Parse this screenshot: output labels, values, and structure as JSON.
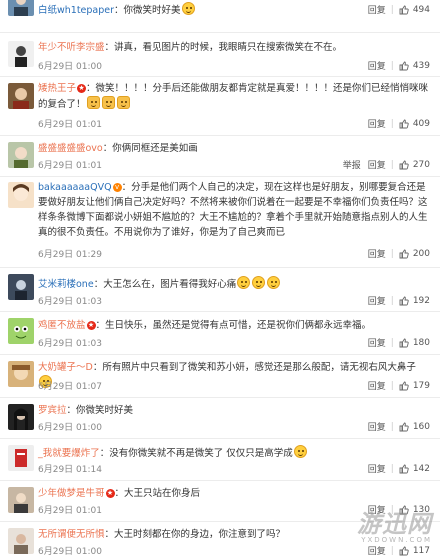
{
  "ui": {
    "reply_label": "回复",
    "report_label": "举报",
    "separator": "|"
  },
  "comments": [
    {
      "user": "白纸wh1tepaper",
      "badge": "",
      "text": "：你微笑时好美",
      "emojis": [
        "cry"
      ],
      "time": "",
      "likes": "494"
    },
    {
      "user": "年少不听李宗盛",
      "badge": "",
      "text": "：讲真，看见图片的时候，我眼睛只在搜索微笑在不在。",
      "time": "6月29日 01:00",
      "likes": "439"
    },
    {
      "user": "矮热王子",
      "badge": "star",
      "text": "：微笑！！！！分手后还能做朋友都肯定就是真爱！！！！还是你们已经悄悄咪咪的复合了！",
      "emojis": [
        "cat",
        "cat",
        "cat"
      ],
      "time": "6月29日 01:01",
      "likes": "409"
    },
    {
      "user": "盛盛盛盛盛ovo",
      "badge": "",
      "text": "：你俩同框还是美如画",
      "time": "6月29日 01:01",
      "likes": "270",
      "report": true
    },
    {
      "user": "bakaaaaaaQVQ",
      "badge": "v",
      "text": "：分手是他们两个人自己的决定，现在这样也是好朋友，别哪要复合还是要做好朋友让他们俩自己决定好吗？不然将来被你们说着在一起要是不幸福你们负责任吗？这样条条微博下面都说小妍姐不尴尬的？大王不尴尬的？拿着个手里就开始随意指点别人的人生真的很不负责任。不用说你为了谁好，你是为了自己爽而已",
      "time": "6月29日 01:29",
      "likes": "200"
    },
    {
      "user": "艾米莉楼one",
      "badge": "",
      "text": "：大王怎么在，图片看得我好心痛",
      "emojis": [
        "cry",
        "cry",
        "cry"
      ],
      "time": "6月29日 01:03",
      "likes": "192"
    },
    {
      "user": "鸡匿不放盐",
      "badge": "star",
      "text": "：生日快乐，虽然还是觉得有点可惜，还是祝你们俩都永远幸福。",
      "time": "6月29日 01:03",
      "likes": "180"
    },
    {
      "user": "大奶罐子～D",
      "badge": "",
      "text": "：所有照片中只看到了微笑和苏小妍，感觉还是那么般配，请无视右风大鼻子",
      "emojis": [
        "laugh"
      ],
      "time": "6月29日 01:07",
      "likes": "179"
    },
    {
      "user": "罗宾拉",
      "badge": "",
      "text": "：你微笑时好美",
      "time": "6月29日 01:00",
      "likes": "160"
    },
    {
      "user": "_我就要爆炸了",
      "badge": "",
      "text": "：没有你微笑就不再是微笑了 仅仅只是高学成",
      "emojis": [
        "smile"
      ],
      "time": "6月29日 01:14",
      "likes": "142"
    },
    {
      "user": "少年做梦是牛哥",
      "badge": "star",
      "text": "：大王只站在你身后",
      "time": "6月29日 01:01",
      "likes": "130"
    },
    {
      "user": "无所谓便无所惧",
      "badge": "",
      "text": "：大王时刻都在你的身边，你注意到了吗？",
      "time": "6月29日 01:00",
      "likes": "117"
    }
  ],
  "watermark": {
    "main": "游迅网",
    "sub": "YXDOWN.COM"
  },
  "colors": {
    "username": "#eb7350",
    "username_alt": "#2a6fb8",
    "time": "#888888",
    "badge": "#ff8200"
  }
}
